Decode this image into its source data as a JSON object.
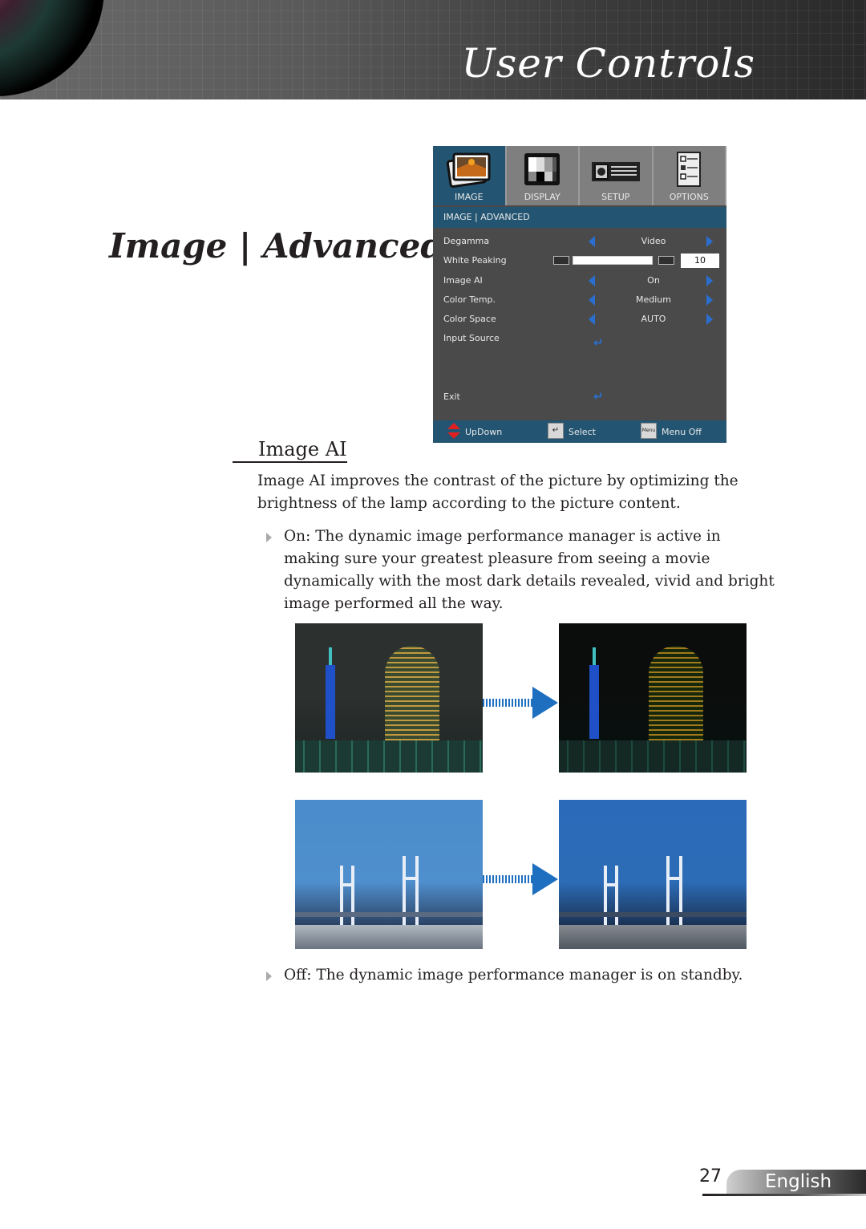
{
  "header": {
    "title": "User Controls",
    "lens_icon": "projector-lens-graphic"
  },
  "section_title": "Image | Advanced",
  "osd": {
    "tabs": [
      {
        "label": "IMAGE",
        "icon": "image-icon",
        "active": true
      },
      {
        "label": "DISPLAY",
        "icon": "display-icon",
        "active": false
      },
      {
        "label": "SETUP",
        "icon": "projector-icon",
        "active": false
      },
      {
        "label": "OPTIONS",
        "icon": "checklist-icon",
        "active": false
      }
    ],
    "subheader": "IMAGE | ADVANCED",
    "rows": [
      {
        "label": "Degamma",
        "value": "Video",
        "type": "selector"
      },
      {
        "label": "White Peaking",
        "value": "10",
        "type": "slider",
        "slider_fraction": 1.0
      },
      {
        "label": "Image AI",
        "value": "On",
        "type": "selector"
      },
      {
        "label": "Color Temp.",
        "value": "Medium",
        "type": "selector"
      },
      {
        "label": "Color Space",
        "value": "AUTO",
        "type": "selector"
      },
      {
        "label": "Input Source",
        "type": "enter",
        "enter_glyph": "↵"
      },
      {
        "label": "Exit",
        "type": "enter",
        "enter_glyph": "↵"
      }
    ],
    "footer": {
      "updown": "UpDown",
      "select": "Select",
      "menu_off": "Menu Off",
      "select_key_glyph": "↵",
      "menu_key_glyph": "Menu"
    }
  },
  "body": {
    "subheading": "Image AI",
    "intro": "Image AI improves the contrast of the picture by optimizing the brightness of the lamp according to the picture content.",
    "bullets": [
      "On: The dynamic image performance manager is active in making sure your greatest pleasure from seeing a movie dynamically with the most dark details revealed, vivid and bright image performed all the way.",
      "Off: The dynamic image performance manager is on standby."
    ],
    "photos": [
      {
        "name": "night-city-before",
        "description": "Night cityscape, original"
      },
      {
        "name": "night-city-after",
        "description": "Night cityscape, Image AI applied"
      },
      {
        "name": "bridge-before",
        "description": "Bridge daytime, original"
      },
      {
        "name": "bridge-after",
        "description": "Bridge daytime, Image AI applied"
      }
    ]
  },
  "footer": {
    "page_number": "27",
    "language": "English"
  },
  "colors": {
    "osd_accent": "#235572",
    "osd_background": "#4a4a4a",
    "arrow_blue": "#2a6fd0",
    "text": "#231f20"
  }
}
